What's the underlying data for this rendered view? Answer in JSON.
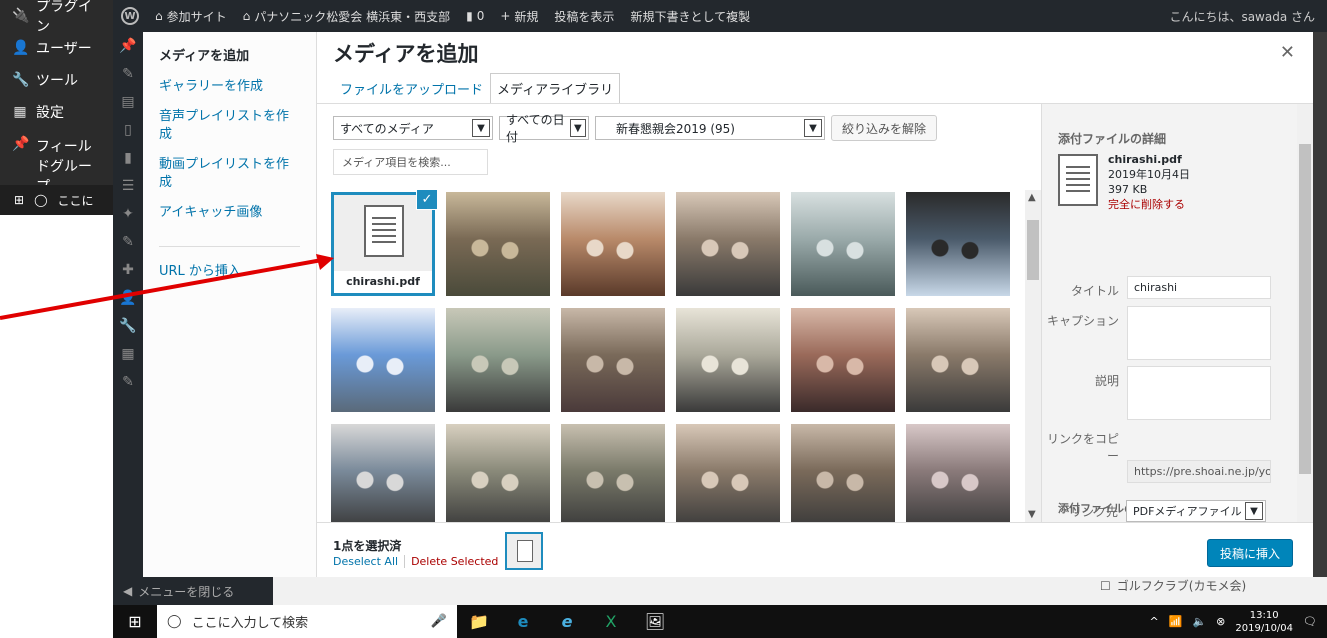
{
  "adminbar": {
    "site_name": "参加サイト",
    "org": "パナソニック松愛会 横浜東・西支部",
    "comments": "0",
    "new_label": "新規",
    "view_post": "投稿を表示",
    "duplicate": "新規下書きとして複製",
    "greeting": "こんにちは、sawada さん"
  },
  "winmenu": {
    "items": [
      {
        "icon": "plugin-icon",
        "label": "プラグイン"
      },
      {
        "icon": "user-icon",
        "label": "ユーザー"
      },
      {
        "icon": "wrench-icon",
        "label": "ツール"
      },
      {
        "icon": "settings-icon",
        "label": "設定"
      },
      {
        "icon": "pin-icon",
        "label": "フィールドグループ"
      }
    ],
    "search_stub": "ここに"
  },
  "modal": {
    "title": "メディアを追加",
    "menu": [
      "メディアを追加",
      "ギャラリーを作成",
      "音声プレイリストを作成",
      "動画プレイリストを作成",
      "アイキャッチ画像"
    ],
    "menu_extra": "URL から挿入",
    "tabs": [
      "ファイルをアップロード",
      "メディアライブラリ"
    ],
    "filters": {
      "media_type": "すべてのメディア",
      "date": "すべての日付",
      "album": "新春懇親会2019 (95)",
      "clear": "絞り込みを解除"
    },
    "search_placeholder": "メディア項目を検索..."
  },
  "grid": {
    "attachment": {
      "filename": "chirashi.pdf"
    },
    "photos": [
      {
        "colors": [
          "#7a6a55",
          "#c8b89a",
          "#4a4a3a"
        ]
      },
      {
        "colors": [
          "#b98a6a",
          "#e8d8c8",
          "#5a3a2a"
        ]
      },
      {
        "colors": [
          "#8a7a6a",
          "#d8c8b8",
          "#3a3a3a"
        ]
      },
      {
        "colors": [
          "#9aaaaa",
          "#d8e0e0",
          "#4a5a5a"
        ]
      },
      {
        "colors": [
          "#4a5a6a",
          "#2a2a2a",
          "#c8d8e8"
        ]
      },
      {
        "colors": [
          "#6a9ad8",
          "#e8eef8",
          "#5a6a7a"
        ]
      },
      {
        "colors": [
          "#8a9a8a",
          "#c8c8b8",
          "#3a3a3a"
        ]
      },
      {
        "colors": [
          "#7a6a5a",
          "#c8b8a8",
          "#4a3a3a"
        ]
      },
      {
        "colors": [
          "#aaa89a",
          "#e8e4d8",
          "#3a3a3a"
        ]
      },
      {
        "colors": [
          "#9a6a5a",
          "#d8b8a8",
          "#3a2a2a"
        ]
      },
      {
        "colors": [
          "#8a7a6a",
          "#d8c8b8",
          "#3a3a3a"
        ]
      },
      {
        "colors": [
          "#7a8a9a",
          "#d8d8d8",
          "#3a3a3a"
        ]
      },
      {
        "colors": [
          "#8a8a7a",
          "#d8d0c0",
          "#3a3a3a"
        ]
      },
      {
        "colors": [
          "#7a7a6a",
          "#c8c0b0",
          "#3a3a3a"
        ]
      },
      {
        "colors": [
          "#8a7a6a",
          "#d8c8b8",
          "#3a3a3a"
        ]
      },
      {
        "colors": [
          "#7a6a5a",
          "#c8b8a8",
          "#3a3a3a"
        ]
      },
      {
        "colors": [
          "#8a7a7a",
          "#d8c8c8",
          "#3a3a3a"
        ]
      }
    ]
  },
  "details": {
    "heading": "添付ファイルの詳細",
    "filename": "chirashi.pdf",
    "date": "2019年10月4日",
    "size": "397 KB",
    "delete": "完全に削除する",
    "title_label": "タイトル",
    "title_value": "chirashi",
    "caption_label": "キャプション",
    "desc_label": "説明",
    "link_label": "リンクをコピー",
    "link_value": "https://pre.shoai.ne.jp/yoko",
    "display_heading": "添付ファイルの表示設定",
    "link_to_label": "リンク先",
    "link_to_value": "PDFメディアファイル"
  },
  "toolbar": {
    "selected": "1点を選択済",
    "deselect": "Deselect All",
    "delete_selected": "Delete Selected",
    "insert": "投稿に挿入"
  },
  "behind": {
    "collapse": "メニューを閉じる",
    "golf": "ゴルフクラブ(カモメ会)"
  },
  "taskbar": {
    "search": "ここに入力して検索",
    "time": "13:10",
    "date": "2019/10/04"
  },
  "colors": {
    "accent": "#0073aa",
    "primary_button": "#0085ba",
    "selection": "#1e8cbe",
    "danger": "#a00",
    "arrow": "#e00000"
  }
}
